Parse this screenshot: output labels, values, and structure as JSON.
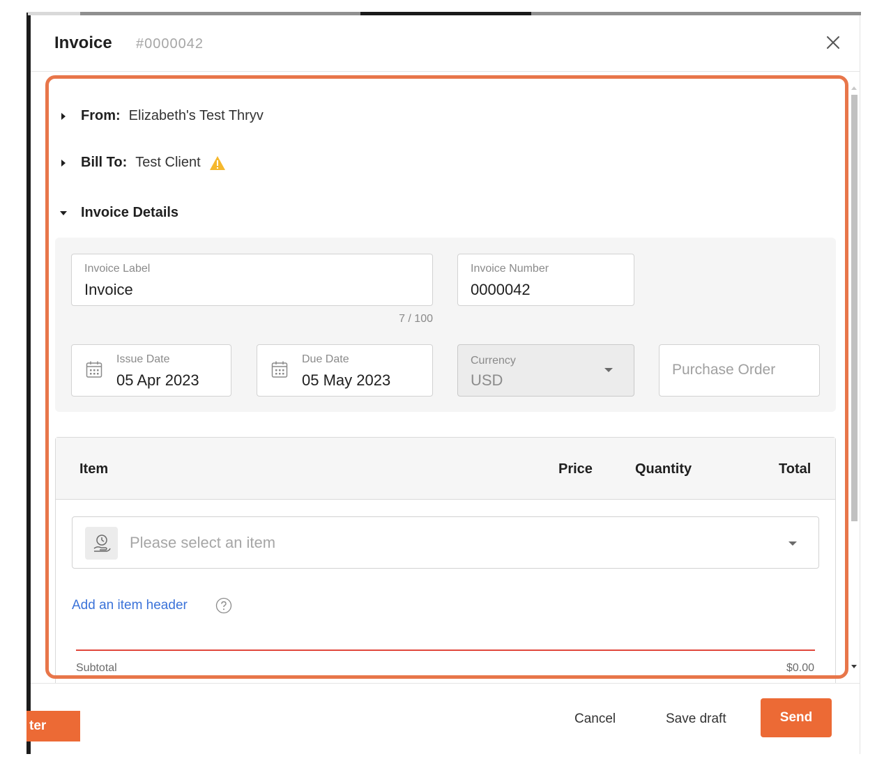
{
  "modal": {
    "title": "Invoice",
    "subtitle": "#0000042"
  },
  "sections": {
    "from": {
      "label": "From:",
      "value": "Elizabeth's Test Thryv"
    },
    "bill_to": {
      "label": "Bill To:",
      "value": "Test Client"
    },
    "invoice_details": {
      "label": "Invoice Details"
    }
  },
  "fields": {
    "invoice_label": {
      "label": "Invoice Label",
      "value": "Invoice",
      "counter": "7 / 100"
    },
    "invoice_number": {
      "label": "Invoice Number",
      "value": "0000042"
    },
    "issue_date": {
      "label": "Issue Date",
      "value": "05 Apr 2023"
    },
    "due_date": {
      "label": "Due Date",
      "value": "05 May 2023"
    },
    "currency": {
      "label": "Currency",
      "value": "USD"
    },
    "purchase_order": {
      "placeholder": "Purchase Order"
    }
  },
  "items": {
    "headers": {
      "item": "Item",
      "price": "Price",
      "quantity": "Quantity",
      "total": "Total"
    },
    "select_placeholder": "Please select an item",
    "add_header_link": "Add an item header",
    "subtotal_label": "Subtotal",
    "subtotal_value": "$0.00"
  },
  "footer": {
    "cancel": "Cancel",
    "save_draft": "Save draft",
    "send": "Send"
  },
  "background": {
    "orange_button_partial": "ter"
  },
  "colors": {
    "accent": "#ec6a35",
    "highlight_border": "#e8764a",
    "link": "#3b73d9",
    "warning": "#f5b82e",
    "divider_red": "#e0463a"
  },
  "icons": {
    "close": "close-icon",
    "warning": "warning-icon",
    "calendar": "calendar-icon",
    "item_select": "hand-coin-icon",
    "help": "help-icon"
  }
}
